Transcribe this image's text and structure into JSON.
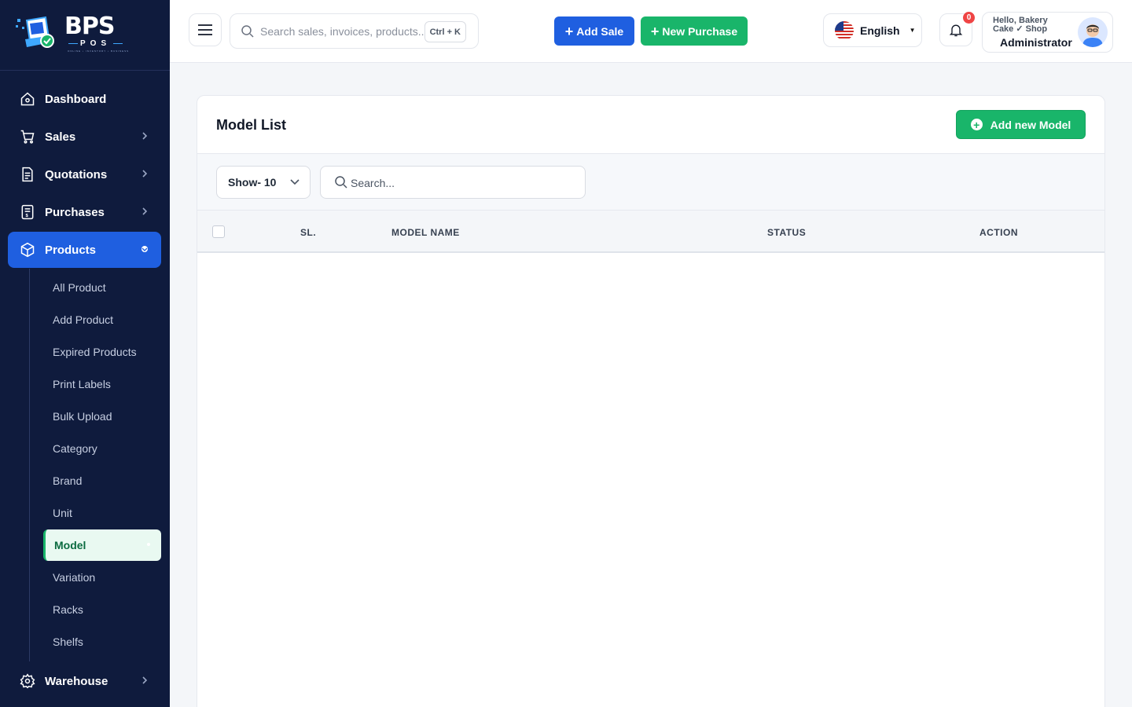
{
  "brand": {
    "name": "BPS",
    "sub": "POS",
    "tagline": "ONLINE • INVENTORY • BUSINESS"
  },
  "sidebar": {
    "items": [
      {
        "label": "Dashboard",
        "icon": "home-icon"
      },
      {
        "label": "Sales",
        "icon": "cart-icon"
      },
      {
        "label": "Quotations",
        "icon": "document-icon"
      },
      {
        "label": "Purchases",
        "icon": "receipt-icon"
      },
      {
        "label": "Products",
        "icon": "box-icon",
        "active": true
      },
      {
        "label": "Warehouse",
        "icon": "gear-icon"
      }
    ],
    "products_sub": [
      {
        "label": "All Product"
      },
      {
        "label": "Add Product"
      },
      {
        "label": "Expired Products"
      },
      {
        "label": "Print Labels"
      },
      {
        "label": "Bulk Upload"
      },
      {
        "label": "Category"
      },
      {
        "label": "Brand"
      },
      {
        "label": "Unit"
      },
      {
        "label": "Model",
        "active": true
      },
      {
        "label": "Variation"
      },
      {
        "label": "Racks"
      },
      {
        "label": "Shelfs"
      }
    ]
  },
  "header": {
    "search_placeholder": "Search sales, invoices, products...",
    "shortcut": "Ctrl + K",
    "add_sale": "Add Sale",
    "new_purchase": "New Purchase",
    "language": "English",
    "notification_count": "0",
    "greeting": "Hello, Bakery Cake ✓ Shop",
    "role": "Administrator"
  },
  "page": {
    "title": "Model List",
    "add_button": "Add new Model",
    "show_label": "Show- 10",
    "search_placeholder": "Search...",
    "columns": [
      "SL.",
      "MODEL NAME",
      "STATUS",
      "ACTION"
    ]
  },
  "colors": {
    "sidebar_bg": "#0f1b3d",
    "primary_blue": "#1f5fe0",
    "primary_green": "#19b56a",
    "badge_red": "#ef4444"
  }
}
